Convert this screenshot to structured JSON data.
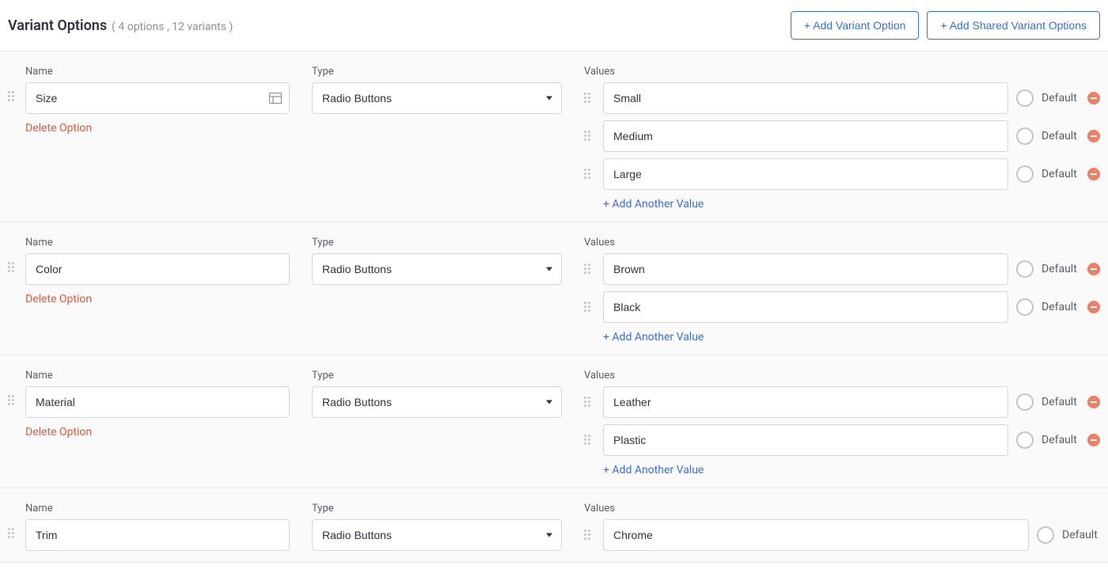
{
  "header": {
    "title": "Variant Options",
    "subtitle": "( 4 options , 12 variants )",
    "add_option_label": "+ Add Variant Option",
    "add_shared_label": "+ Add Shared Variant Options"
  },
  "labels": {
    "name": "Name",
    "type": "Type",
    "values": "Values",
    "default": "Default",
    "delete_option": "Delete Option",
    "add_another_value": "+ Add Another Value"
  },
  "options": [
    {
      "name": "Size",
      "type": "Radio Buttons",
      "show_icon": true,
      "show_delete": true,
      "values": [
        {
          "value": "Small",
          "show_remove": true
        },
        {
          "value": "Medium",
          "show_remove": true
        },
        {
          "value": "Large",
          "show_remove": true
        }
      ],
      "show_add": true
    },
    {
      "name": "Color",
      "type": "Radio Buttons",
      "show_icon": false,
      "show_delete": true,
      "values": [
        {
          "value": "Brown",
          "show_remove": true
        },
        {
          "value": "Black",
          "show_remove": true
        }
      ],
      "show_add": true
    },
    {
      "name": "Material",
      "type": "Radio Buttons",
      "show_icon": false,
      "show_delete": true,
      "values": [
        {
          "value": "Leather",
          "show_remove": true
        },
        {
          "value": "Plastic",
          "show_remove": true
        }
      ],
      "show_add": true
    },
    {
      "name": "Trim",
      "type": "Radio Buttons",
      "show_icon": false,
      "show_delete": false,
      "values": [
        {
          "value": "Chrome",
          "show_remove": false
        }
      ],
      "show_add": false
    }
  ]
}
